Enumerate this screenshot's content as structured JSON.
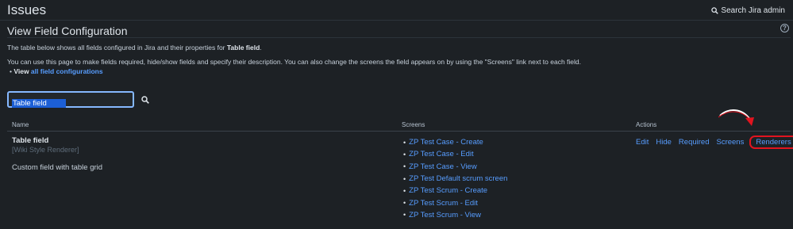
{
  "header": {
    "title": "Issues",
    "search_label": "Search Jira admin"
  },
  "page": {
    "title": "View Field Configuration",
    "intro_prefix": "The table below shows all fields configured in Jira and their properties for ",
    "intro_field": "Table field",
    "intro_suffix": ".",
    "description": "You can use this page to make fields required, hide/show fields and specify their description. You can also change the screens the field appears on by using the \"Screens\" link next to each field.",
    "bullet_prefix": "View ",
    "bullet_link": "all field configurations"
  },
  "search": {
    "value": "Table field"
  },
  "table": {
    "headers": {
      "name": "Name",
      "screens": "Screens",
      "actions": "Actions"
    },
    "row": {
      "name": "Table field",
      "renderer": "[Wiki Style Renderer]",
      "description": "Custom field with table grid",
      "screens": [
        "ZP Test Case - Create",
        "ZP Test Case - Edit",
        "ZP Test Case - View",
        "ZP Test Default scrum screen",
        "ZP Test Scrum - Create",
        "ZP Test Scrum - Edit",
        "ZP Test Scrum - View"
      ],
      "actions": [
        "Edit",
        "Hide",
        "Required",
        "Screens",
        "Renderers"
      ]
    }
  },
  "colors": {
    "background": "#1d2125",
    "link": "#579dff",
    "highlight": "#e2141f"
  }
}
